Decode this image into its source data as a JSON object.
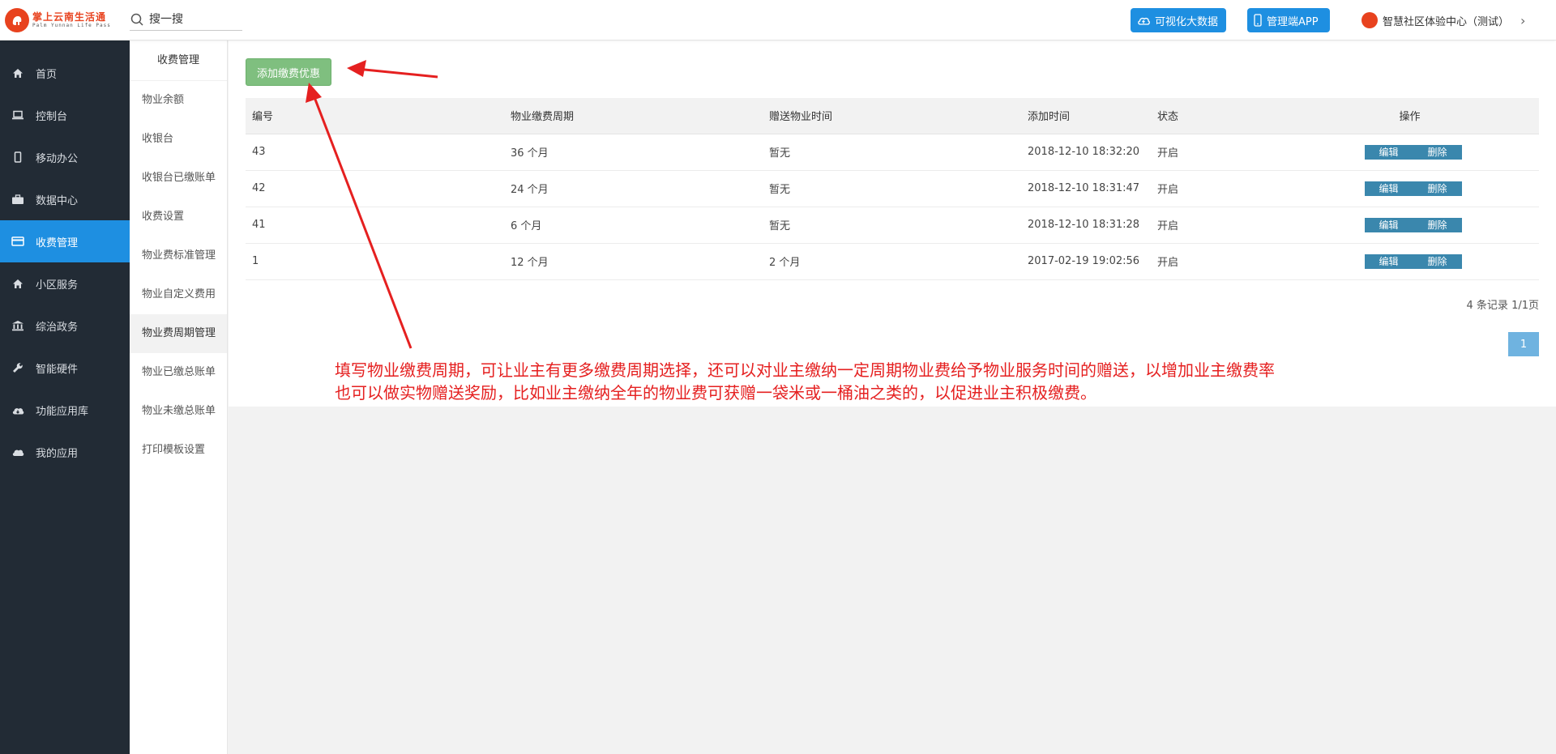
{
  "header": {
    "logo_cn": "掌上云南生活通",
    "logo_en": "Palm Yunnan Life Pass",
    "search_placeholder": "搜一搜",
    "btn_bigdata": "可视化大数据",
    "btn_app": "管理端APP",
    "org_name": "智慧社区体验中心（测试）"
  },
  "nav": {
    "items": [
      {
        "label": "首页",
        "icon": "home-icon"
      },
      {
        "label": "控制台",
        "icon": "laptop-icon"
      },
      {
        "label": "移动办公",
        "icon": "mobile-icon"
      },
      {
        "label": "数据中心",
        "icon": "briefcase-icon"
      },
      {
        "label": "收费管理",
        "icon": "card-icon",
        "active": true
      },
      {
        "label": "小区服务",
        "icon": "home-icon"
      },
      {
        "label": "综治政务",
        "icon": "bank-icon"
      },
      {
        "label": "智能硬件",
        "icon": "wrench-icon"
      },
      {
        "label": "功能应用库",
        "icon": "cloud-download-icon"
      },
      {
        "label": "我的应用",
        "icon": "cloud-icon"
      }
    ]
  },
  "subnav": {
    "title": "收费管理",
    "items": [
      {
        "label": "物业余额"
      },
      {
        "label": "收银台"
      },
      {
        "label": "收银台已缴账单"
      },
      {
        "label": "收费设置"
      },
      {
        "label": "物业费标准管理"
      },
      {
        "label": "物业自定义费用"
      },
      {
        "label": "物业费周期管理",
        "active": true
      },
      {
        "label": "物业已缴总账单"
      },
      {
        "label": "物业未缴总账单"
      },
      {
        "label": "打印模板设置"
      }
    ]
  },
  "main": {
    "add_button": "添加缴费优惠",
    "columns": [
      "编号",
      "物业缴费周期",
      "赠送物业时间",
      "添加时间",
      "状态",
      "操作"
    ],
    "rows": [
      {
        "id": "43",
        "period": "36 个月",
        "gift": "暂无",
        "time": "2018-12-10 18:32:20",
        "status": "开启"
      },
      {
        "id": "42",
        "period": "24 个月",
        "gift": "暂无",
        "time": "2018-12-10 18:31:47",
        "status": "开启"
      },
      {
        "id": "41",
        "period": "6 个月",
        "gift": "暂无",
        "time": "2018-12-10 18:31:28",
        "status": "开启"
      },
      {
        "id": "1",
        "period": "12 个月",
        "gift": "2 个月",
        "time": "2017-02-19 19:02:56",
        "status": "开启"
      }
    ],
    "edit_label": "编辑",
    "delete_label": "删除",
    "pager_info": "4 条记录 1/1页",
    "pager_current": "1"
  },
  "annotation": {
    "line1": "填写物业缴费周期，可让业主有更多缴费周期选择，还可以对业主缴纳一定周期物业费给予物业服务时间的赠送，以增加业主缴费率",
    "line2": "也可以做实物赠送奖励，比如业主缴纳全年的物业费可获赠一袋米或一桶油之类的，以促进业主积极缴费。"
  },
  "colors": {
    "accent": "#1e8fe1",
    "sidebar_bg": "#222b35",
    "add_button": "#7fbf7f",
    "op_button": "#3a87ad",
    "annotation": "#e52020",
    "status_on": "#5cb85c",
    "gift_none": "#e74c3c"
  }
}
